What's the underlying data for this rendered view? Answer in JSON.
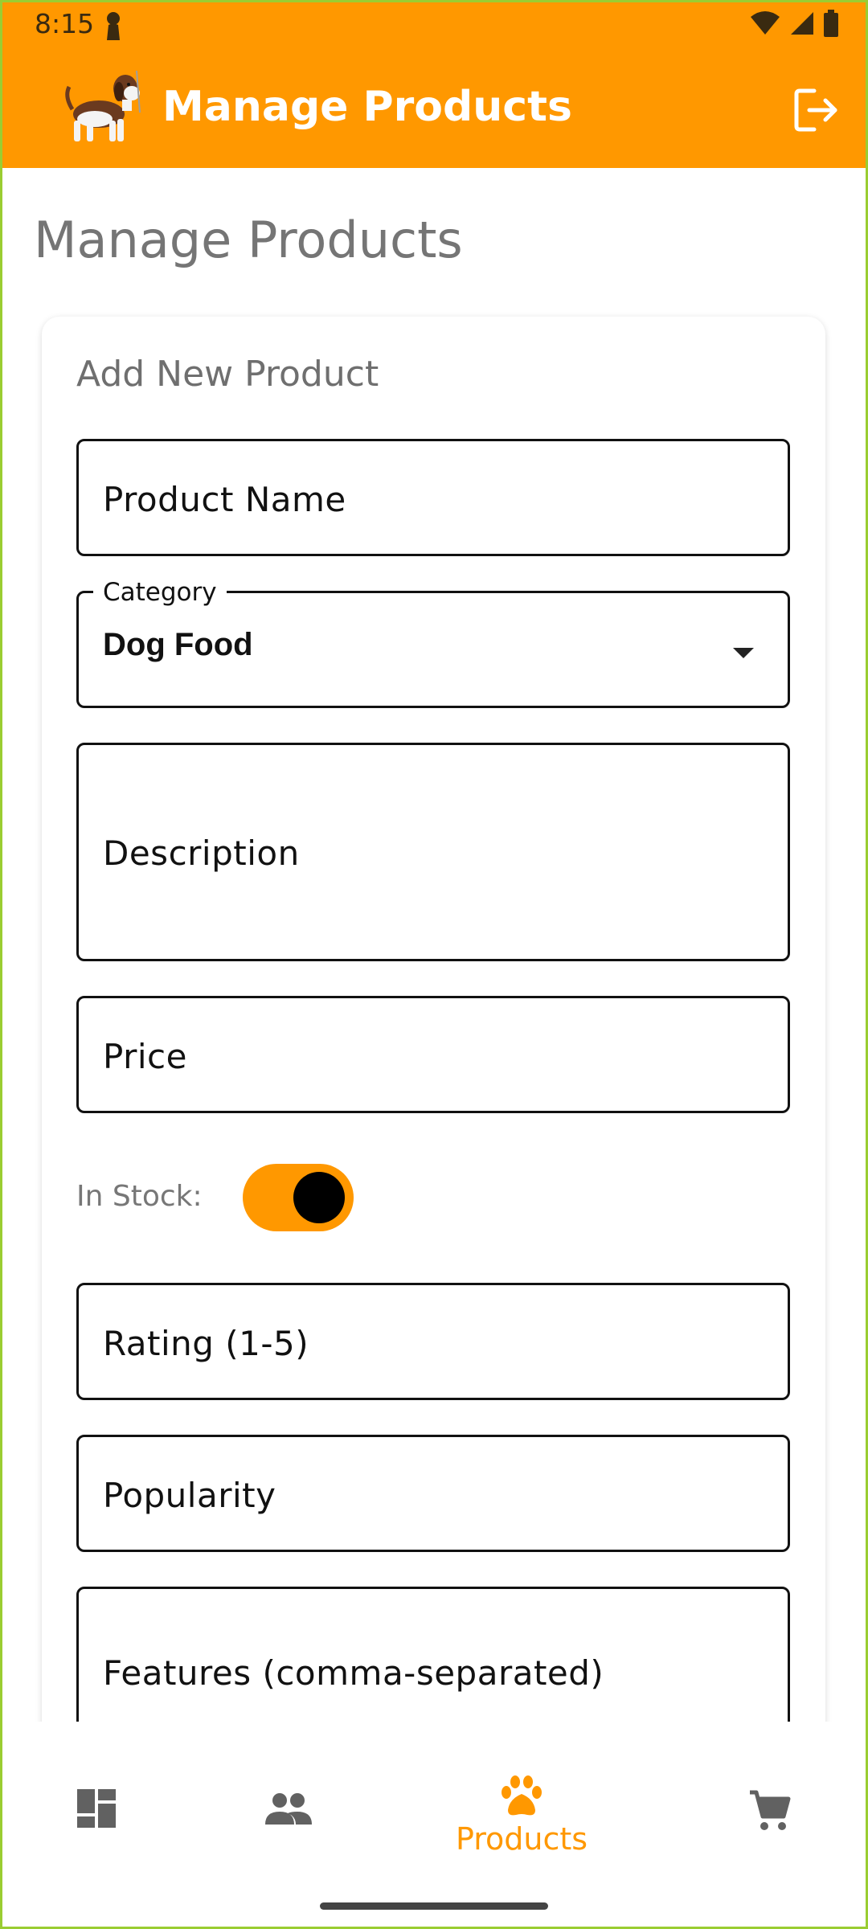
{
  "status_bar": {
    "time": "8:15"
  },
  "app_bar": {
    "title": "Manage Products",
    "logout_icon": "logout-icon",
    "logo": "beagle-dog-logo"
  },
  "page": {
    "title": "Manage Products"
  },
  "form": {
    "title": "Add New Product",
    "product_name_placeholder": "Product Name",
    "category": {
      "label": "Category",
      "value": "Dog Food"
    },
    "description_placeholder": "Description",
    "price_placeholder": "Price",
    "in_stock": {
      "label": "In Stock:",
      "checked": true
    },
    "rating_placeholder": "Rating (1-5)",
    "popularity_placeholder": "Popularity",
    "features_placeholder": "Features (comma-separated)"
  },
  "bottom_nav": {
    "items": [
      {
        "icon": "dashboard-icon",
        "label": "",
        "active": false
      },
      {
        "icon": "people-icon",
        "label": "",
        "active": false
      },
      {
        "icon": "paw-icon",
        "label": "Products",
        "active": true
      },
      {
        "icon": "cart-icon",
        "label": "",
        "active": false
      }
    ]
  },
  "colors": {
    "accent": "#ff9800",
    "text": "#111111",
    "muted": "#757575"
  }
}
